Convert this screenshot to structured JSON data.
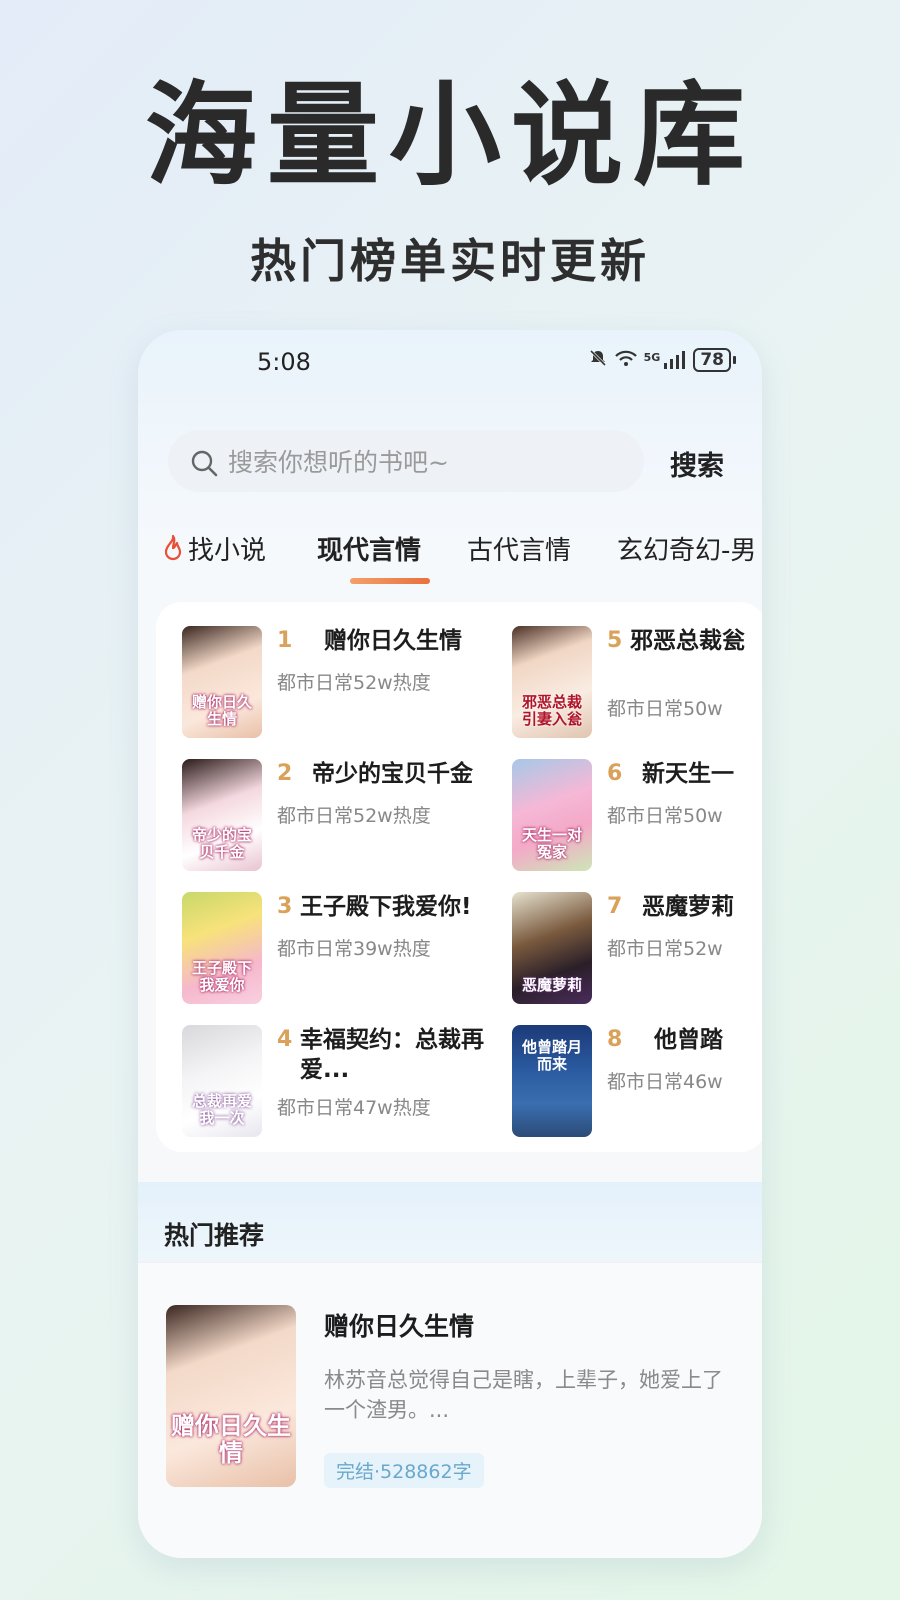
{
  "promo": {
    "headline": "海量小说库",
    "subline": "热门榜单实时更新"
  },
  "status_bar": {
    "time": "5:08",
    "signal_label": "5G",
    "battery": "78",
    "icons": [
      "mute-icon",
      "wifi-icon",
      "signal-icon",
      "battery-icon"
    ]
  },
  "search": {
    "placeholder": "搜索你想听的书吧~",
    "button_label": "搜索"
  },
  "tabs": [
    {
      "label": "找小说",
      "icon": "fire-icon"
    },
    {
      "label": "现代言情",
      "active": true
    },
    {
      "label": "古代言情"
    },
    {
      "label": "玄幻奇幻-男"
    }
  ],
  "ranking": [
    {
      "rank": "1",
      "title": "赠你日久生情",
      "meta": "都市日常52w热度",
      "cover_text": "赠你日久生情"
    },
    {
      "rank": "2",
      "title": "帝少的宝贝千金",
      "meta": "都市日常52w热度",
      "cover_text": "帝少的宝贝千金"
    },
    {
      "rank": "3",
      "title": "王子殿下我爱你!",
      "meta": "都市日常39w热度",
      "cover_text": "王子殿下我爱你"
    },
    {
      "rank": "4",
      "title": "幸福契约：总裁再爱...",
      "meta": "都市日常47w热度",
      "cover_text": "总裁再爱我一次"
    },
    {
      "rank": "5",
      "title": "邪恶总裁瓮",
      "meta": "都市日常50w",
      "cover_text": "邪恶总裁引妻入瓮"
    },
    {
      "rank": "6",
      "title": "新天生一",
      "meta": "都市日常50w",
      "cover_text": "天生一对冤家"
    },
    {
      "rank": "7",
      "title": "恶魔萝莉",
      "meta": "都市日常52w",
      "cover_text": "恶魔萝莉"
    },
    {
      "rank": "8",
      "title": "他曾踏",
      "meta": "都市日常46w",
      "cover_text": "他曾踏月而来"
    }
  ],
  "recommend": {
    "section_title": "热门推荐",
    "book": {
      "title": "赠你日久生情",
      "description": "林苏音总觉得自己是瞎，上辈子，她爱上了一个渣男。...",
      "tag": "完结·528862字",
      "cover_text": "赠你日久生情"
    }
  }
}
